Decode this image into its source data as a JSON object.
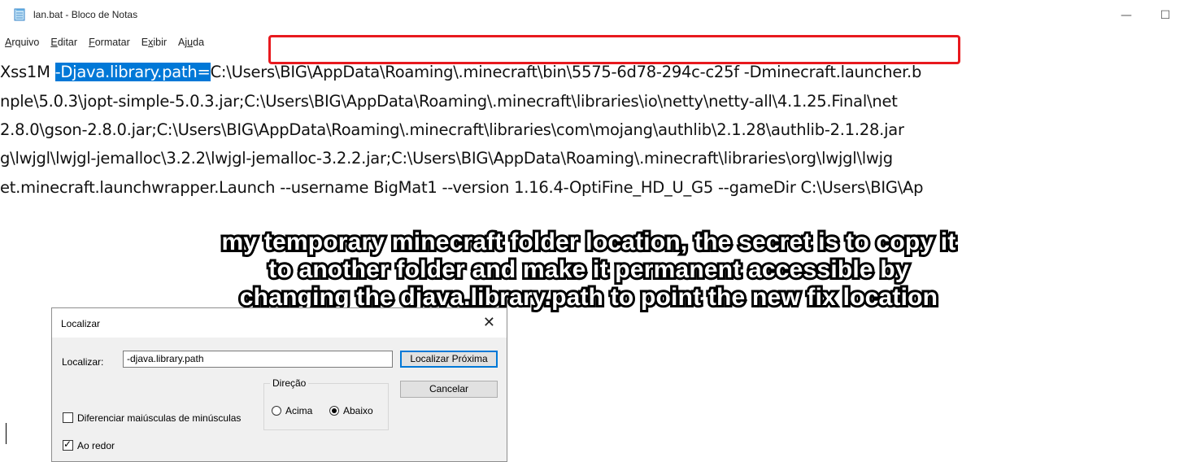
{
  "window": {
    "title": "lan.bat - Bloco de Notas",
    "minimize_glyph": "—",
    "maximize_glyph": "☐"
  },
  "menu": {
    "items": [
      {
        "underline": "A",
        "rest": "rquivo",
        "name": "Arquivo"
      },
      {
        "underline": "E",
        "rest": "ditar",
        "name": "Editar"
      },
      {
        "underline": "F",
        "rest": "ormatar",
        "name": "Formatar"
      },
      {
        "underline": "x",
        "pre": "E",
        "rest": "ibir",
        "name": "Exibir"
      },
      {
        "underline": "u",
        "pre": "Aj",
        "rest": "da",
        "name": "Ajuda"
      }
    ]
  },
  "editor": {
    "line1_prefix": "Xss1M ",
    "line1_selected": "-Djava.library.path",
    "line1_equals": "=",
    "line1_path": "C:\\Users\\BIG\\AppData\\Roaming\\.minecraft\\bin\\5575-6d78-294c-c25f",
    "line1_rest": " -Dminecraft.launcher.b",
    "line2": "nple\\5.0.3\\jopt-simple-5.0.3.jar;C:\\Users\\BIG\\AppData\\Roaming\\.minecraft\\libraries\\io\\netty\\netty-all\\4.1.25.Final\\net",
    "line3": "2.8.0\\gson-2.8.0.jar;C:\\Users\\BIG\\AppData\\Roaming\\.minecraft\\libraries\\com\\mojang\\authlib\\2.1.28\\authlib-2.1.28.jar",
    "line4": "g\\lwjgl\\lwjgl-jemalloc\\3.2.2\\lwjgl-jemalloc-3.2.2.jar;C:\\Users\\BIG\\AppData\\Roaming\\.minecraft\\libraries\\org\\lwjgl\\lwjg",
    "line5": "et.minecraft.launchwrapper.Launch --username BigMat1 --version 1.16.4-OptiFine_HD_U_G5 --gameDir C:\\Users\\BIG\\Ap"
  },
  "caption": {
    "line1": "my temporary minecraft folder location, the secret is to copy it",
    "line2": "to another folder and make it permanent accessible by",
    "line3": "changing the djava.library.path to point the new fix location"
  },
  "find_dialog": {
    "title": "Localizar",
    "close_glyph": "✕",
    "find_label": "Localizar:",
    "find_value": "-djava.library.path",
    "find_next_label": "Localizar Próxima",
    "cancel_label": "Cancelar",
    "direction_title": "Direção",
    "up_label": "Acima",
    "down_label": "Abaixo",
    "direction_selected": "Abaixo",
    "match_case_label": "Diferenciar maiúsculas de minúsculas",
    "match_case_checked": false,
    "wrap_label": "Ao redor",
    "wrap_checked": true
  },
  "colors": {
    "selection": "#0078d7",
    "highlight_box": "#e8191e"
  }
}
